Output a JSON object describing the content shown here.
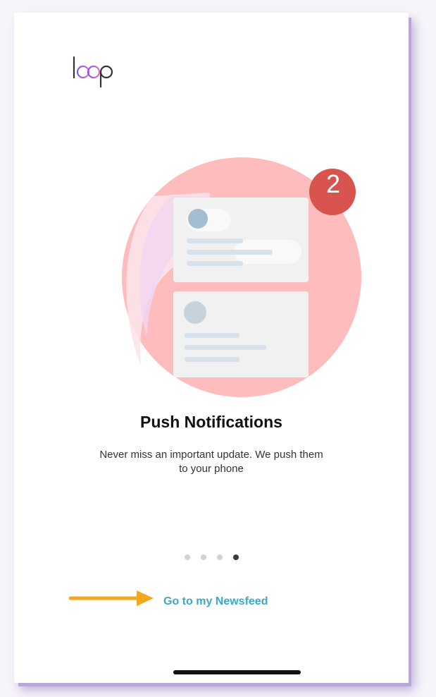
{
  "app": {
    "logo_text": "loop"
  },
  "illustration": {
    "badge_count": "2",
    "icon": "notification-cards-icon"
  },
  "onboarding": {
    "title": "Push Notifications",
    "description": "Never miss an important update. We push them to your phone",
    "pager": {
      "total_pages": 4,
      "active_page": 4
    }
  },
  "actions": {
    "newsfeed_label": "Go to my Newsfeed"
  },
  "colors": {
    "accent": "#3aa9c8",
    "badge": "#d9534f",
    "circle": "#ffbcbc",
    "annotation_arrow": "#f2a81d"
  }
}
